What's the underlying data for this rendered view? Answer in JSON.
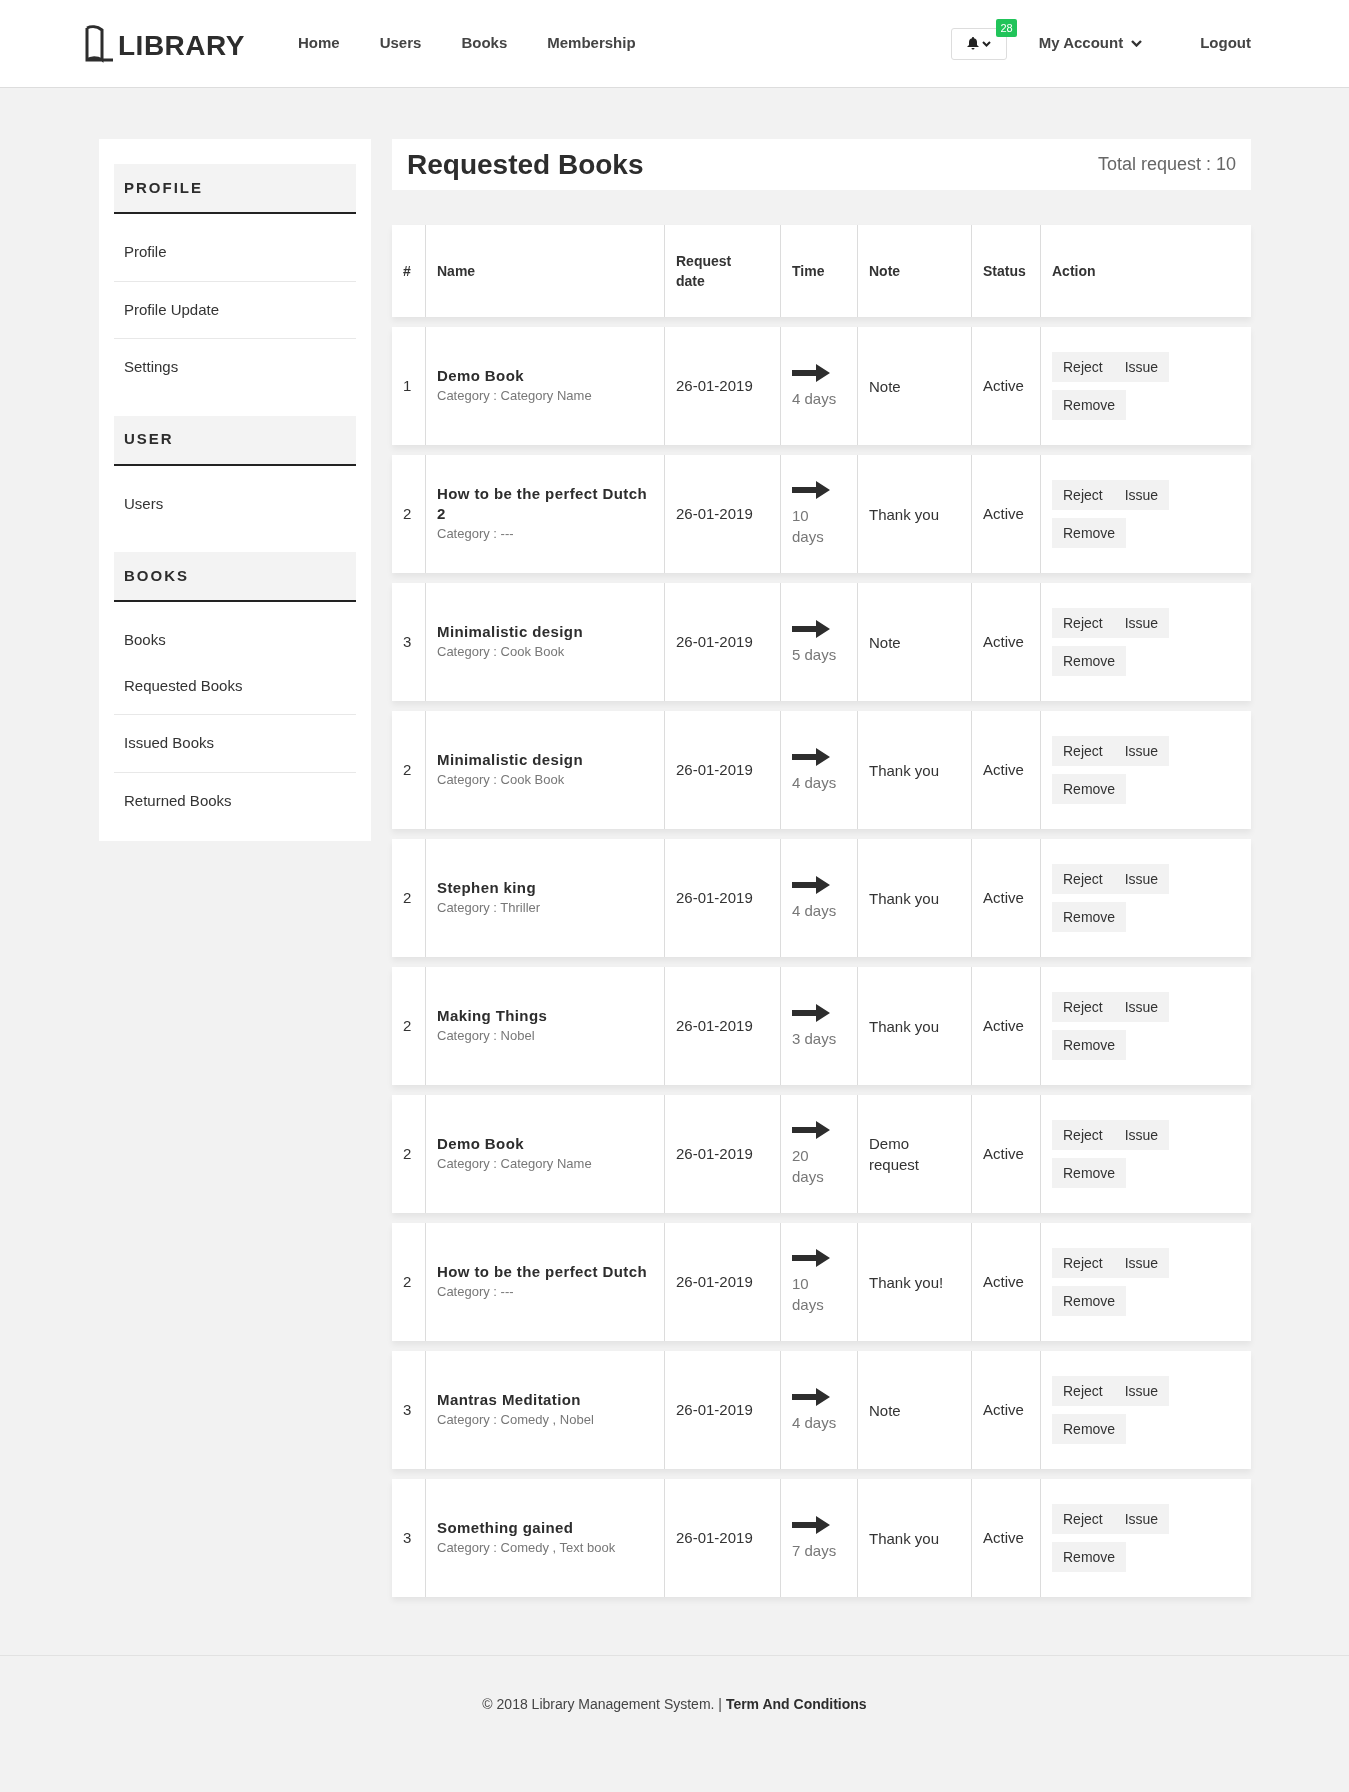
{
  "header": {
    "logo": "LIBRARY",
    "nav": [
      {
        "label": "Home"
      },
      {
        "label": "Users"
      },
      {
        "label": "Books"
      },
      {
        "label": "Membership"
      }
    ],
    "notifications": {
      "count": "28"
    },
    "account": "My Account",
    "logout": "Logout"
  },
  "sidebar": [
    {
      "title": "PROFILE",
      "items": [
        "Profile",
        "Profile Update",
        "Settings"
      ]
    },
    {
      "title": "USER",
      "items": [
        "Users"
      ]
    },
    {
      "title": "BOOKS",
      "items": [
        "Books",
        "Requested Books",
        "Issued Books",
        "Returned Books"
      ]
    }
  ],
  "page": {
    "title": "Requested Books",
    "total": "Total request : 10"
  },
  "table": {
    "columns": [
      "#",
      "Name",
      "Request date",
      "Time",
      "Note",
      "Status",
      "Action"
    ],
    "rows": [
      {
        "num": "1",
        "name": "Demo Book",
        "category": "Category : Category Name",
        "date": "26-01-2019",
        "time": "4 days",
        "note": "Note",
        "status": "Active",
        "actions": [
          "Reject",
          "Issue",
          "Remove"
        ]
      },
      {
        "num": "2",
        "name": "How to be the perfect Dutch 2",
        "category": "Category : ---",
        "date": "26-01-2019",
        "time": "10 days",
        "note": "Thank you",
        "status": "Active",
        "actions": [
          "Reject",
          "Issue",
          "Remove"
        ]
      },
      {
        "num": "3",
        "name": "Minimalistic design",
        "category": "Category : Cook Book",
        "date": "26-01-2019",
        "time": "5 days",
        "note": "Note",
        "status": "Active",
        "actions": [
          "Reject",
          "Issue",
          "Remove"
        ]
      },
      {
        "num": "2",
        "name": "Minimalistic design",
        "category": "Category : Cook Book",
        "date": "26-01-2019",
        "time": "4 days",
        "note": "Thank you",
        "status": "Active",
        "actions": [
          "Reject",
          "Issue",
          "Remove"
        ]
      },
      {
        "num": "2",
        "name": "Stephen king",
        "category": "Category : Thriller",
        "date": "26-01-2019",
        "time": "4 days",
        "note": "Thank you",
        "status": "Active",
        "actions": [
          "Reject",
          "Issue",
          "Remove"
        ]
      },
      {
        "num": "2",
        "name": "Making Things",
        "category": "Category : Nobel",
        "date": "26-01-2019",
        "time": "3 days",
        "note": "Thank you",
        "status": "Active",
        "actions": [
          "Reject",
          "Issue",
          "Remove"
        ]
      },
      {
        "num": "2",
        "name": "Demo Book",
        "category": "Category : Category Name",
        "date": "26-01-2019",
        "time": "20 days",
        "note": "Demo request",
        "status": "Active",
        "actions": [
          "Reject",
          "Issue",
          "Remove"
        ]
      },
      {
        "num": "2",
        "name": "How to be the perfect Dutch",
        "category": "Category : ---",
        "date": "26-01-2019",
        "time": "10 days",
        "note": "Thank you!",
        "status": "Active",
        "actions": [
          "Reject",
          "Issue",
          "Remove"
        ]
      },
      {
        "num": "3",
        "name": "Mantras Meditation",
        "category": "Category : Comedy , Nobel",
        "date": "26-01-2019",
        "time": "4 days",
        "note": "Note",
        "status": "Active",
        "actions": [
          "Reject",
          "Issue",
          "Remove"
        ]
      },
      {
        "num": "3",
        "name": "Something gained",
        "category": "Category : Comedy , Text book",
        "date": "26-01-2019",
        "time": "7 days",
        "note": "Thank you",
        "status": "Active",
        "actions": [
          "Reject",
          "Issue",
          "Remove"
        ]
      }
    ]
  },
  "footer": {
    "text": "© 2018 Library Management System. |",
    "link": "Term And Conditions"
  }
}
